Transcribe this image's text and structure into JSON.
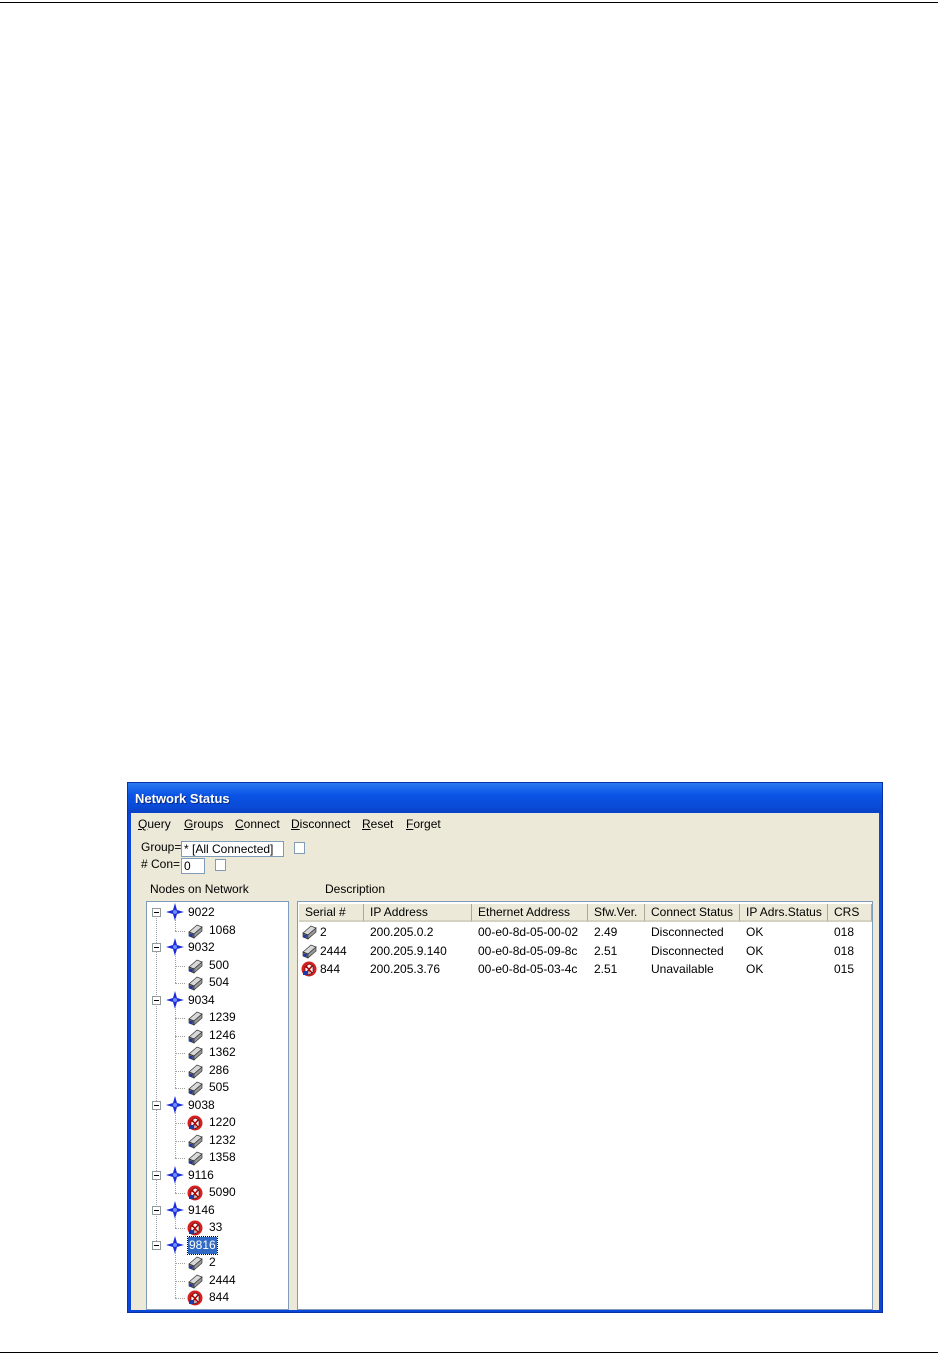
{
  "window": {
    "title": "Network Status"
  },
  "menu": [
    {
      "label": "Query",
      "key": "Q"
    },
    {
      "label": "Groups",
      "key": "G"
    },
    {
      "label": "Connect",
      "key": "C"
    },
    {
      "label": "Disconnect",
      "key": "D"
    },
    {
      "label": "Reset",
      "key": "R"
    },
    {
      "label": "Forget",
      "key": "F"
    }
  ],
  "filters": {
    "group_label": "Group=",
    "group_value": "* [All Connected]",
    "con_label": "# Con=",
    "con_value": "0"
  },
  "panels": {
    "tree_heading": "Nodes on Network",
    "list_heading": "Description"
  },
  "tree": [
    {
      "label": "9022",
      "children": [
        {
          "label": "1068",
          "status": "ok"
        }
      ]
    },
    {
      "label": "9032",
      "children": [
        {
          "label": "500",
          "status": "ok"
        },
        {
          "label": "504",
          "status": "ok"
        }
      ]
    },
    {
      "label": "9034",
      "children": [
        {
          "label": "1239",
          "status": "ok"
        },
        {
          "label": "1246",
          "status": "ok"
        },
        {
          "label": "1362",
          "status": "ok"
        },
        {
          "label": "286",
          "status": "ok"
        },
        {
          "label": "505",
          "status": "ok"
        }
      ]
    },
    {
      "label": "9038",
      "children": [
        {
          "label": "1220",
          "status": "error"
        },
        {
          "label": "1232",
          "status": "ok"
        },
        {
          "label": "1358",
          "status": "ok"
        }
      ]
    },
    {
      "label": "9116",
      "children": [
        {
          "label": "5090",
          "status": "error"
        }
      ]
    },
    {
      "label": "9146",
      "children": [
        {
          "label": "33",
          "status": "error"
        }
      ]
    },
    {
      "label": "9816",
      "selected": true,
      "children": [
        {
          "label": "2",
          "status": "ok"
        },
        {
          "label": "2444",
          "status": "ok"
        },
        {
          "label": "844",
          "status": "error"
        }
      ]
    }
  ],
  "table": {
    "columns": [
      "Serial #",
      "IP Address",
      "Ethernet Address",
      "Sfw.Ver.",
      "Connect Status",
      "IP Adrs.Status",
      "CRS"
    ],
    "rows": [
      {
        "status": "ok",
        "cells": [
          "2",
          "200.205.0.2",
          "00-e0-8d-05-00-02",
          "2.49",
          "Disconnected",
          "OK",
          "018"
        ]
      },
      {
        "status": "ok",
        "cells": [
          "2444",
          "200.205.9.140",
          "00-e0-8d-05-09-8c",
          "2.51",
          "Disconnected",
          "OK",
          "018"
        ]
      },
      {
        "status": "error",
        "cells": [
          "844",
          "200.205.3.76",
          "00-e0-8d-05-03-4c",
          "2.51",
          "Unavailable",
          "OK",
          "015"
        ]
      }
    ]
  },
  "icons": {
    "group": "network-star-icon",
    "device_ok": "device-icon",
    "device_error": "device-error-icon"
  },
  "colors": {
    "title_bar": "#0a54e6",
    "selection": "#316ac5",
    "client_bg": "#ece9d8",
    "group_icon": "#1a2cd8",
    "error_icon": "#d42020"
  }
}
